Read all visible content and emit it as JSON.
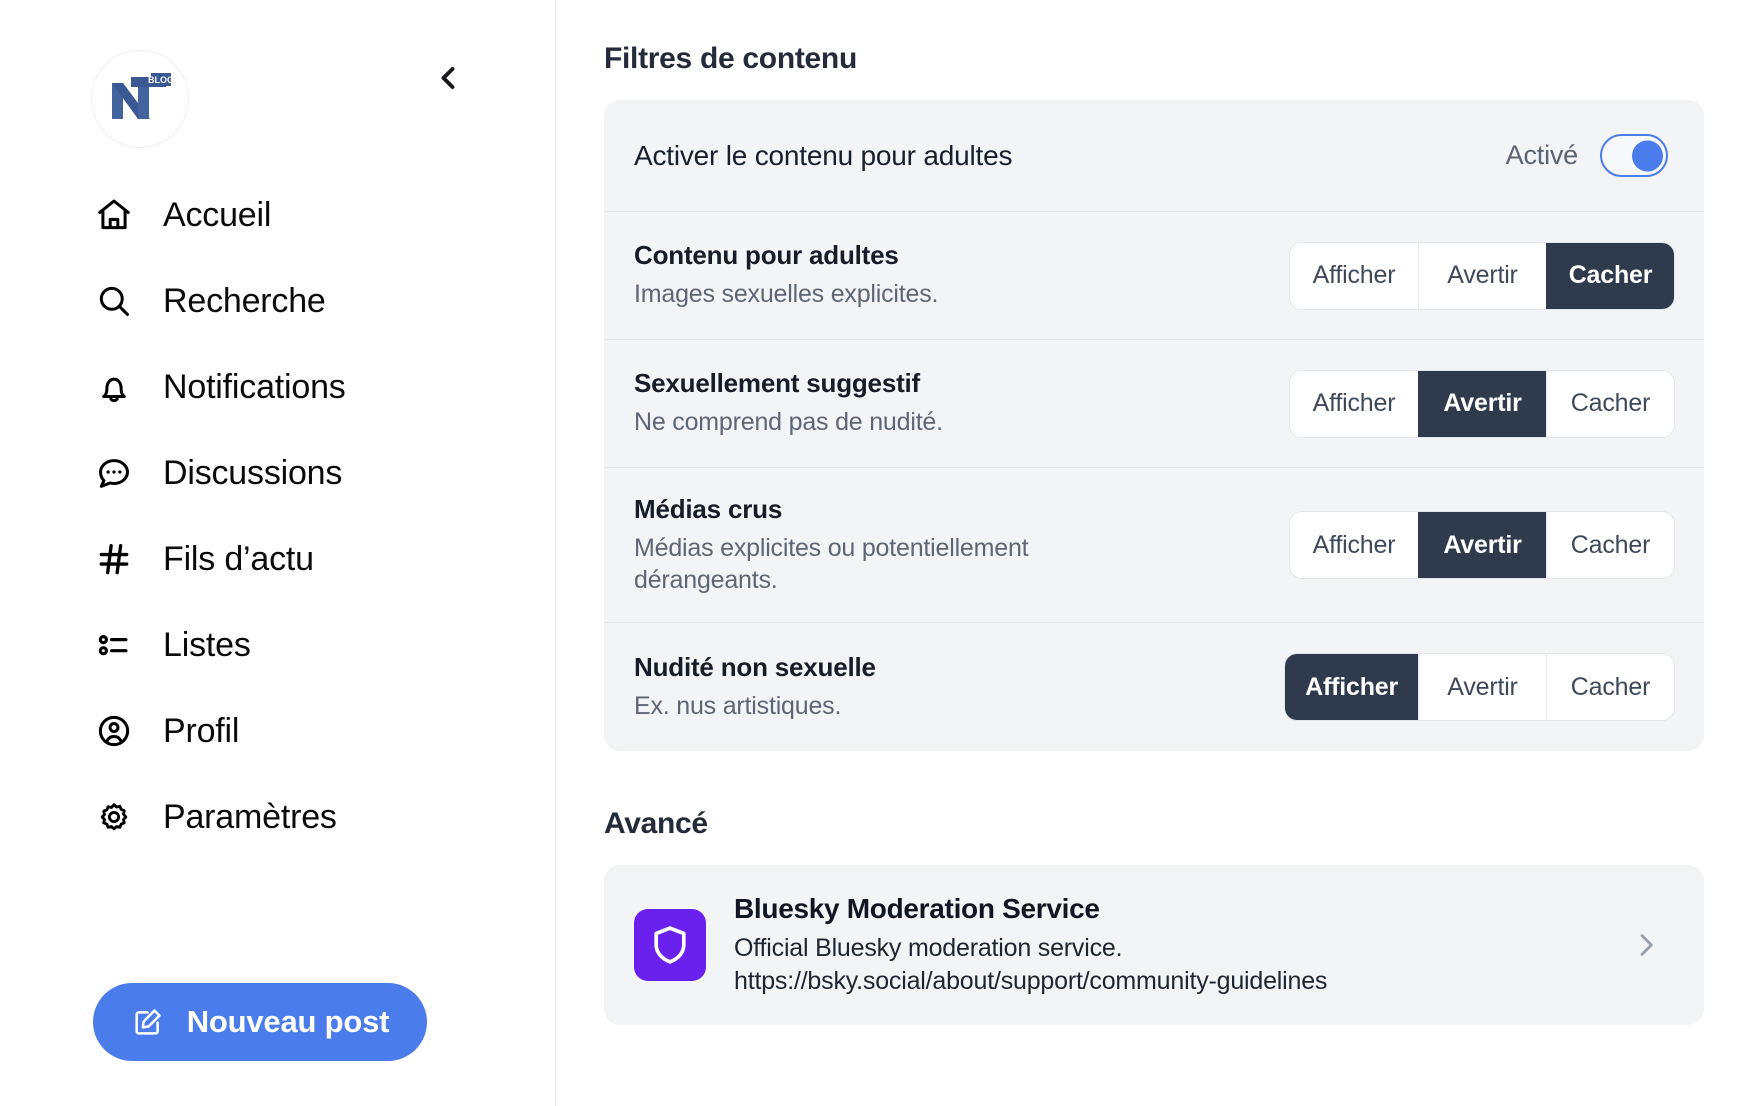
{
  "sidebar": {
    "avatar_alt": "NT BLOG",
    "avatar_text": "NT",
    "avatar_badge": "BLOG",
    "collapse_icon": "chevron-left-icon",
    "items": [
      {
        "label": "Accueil",
        "icon": "home-icon"
      },
      {
        "label": "Recherche",
        "icon": "search-icon"
      },
      {
        "label": "Notifications",
        "icon": "bell-icon"
      },
      {
        "label": "Discussions",
        "icon": "chat-bubble-icon"
      },
      {
        "label": "Fils d’actu",
        "icon": "hash-icon"
      },
      {
        "label": "Listes",
        "icon": "list-icon"
      },
      {
        "label": "Profil",
        "icon": "user-circle-icon"
      },
      {
        "label": "Paramètres",
        "icon": "gear-icon"
      }
    ],
    "compose": {
      "label": "Nouveau post",
      "icon": "compose-pencil-icon",
      "color": "#4a7ceb"
    }
  },
  "main": {
    "content_filters": {
      "title": "Filtres de contenu",
      "adult_toggle": {
        "label": "Activer le contenu pour adultes",
        "state_label": "Activé",
        "enabled": true,
        "accent": "#4a7ceb"
      },
      "options": [
        "Afficher",
        "Avertir",
        "Cacher"
      ],
      "rows": [
        {
          "name": "Contenu pour adultes",
          "description": "Images sexuelles explicites.",
          "selected": "Cacher"
        },
        {
          "name": "Sexuellement suggestif",
          "description": "Ne comprend pas de nudité.",
          "selected": "Avertir"
        },
        {
          "name": "Médias crus",
          "description": "Médias explicites ou potentiellement dérangeants.",
          "selected": "Avertir"
        },
        {
          "name": "Nudité non sexuelle",
          "description": "Ex. nus artistiques.",
          "selected": "Afficher"
        }
      ]
    },
    "advanced": {
      "title": "Avancé",
      "service": {
        "icon": "shield-icon",
        "icon_color": "#6a21ee",
        "title": "Bluesky Moderation Service",
        "description": "Official Bluesky moderation service.",
        "url": "https://bsky.social/about/support/community-guidelines",
        "chevron": "chevron-right-icon"
      }
    }
  }
}
